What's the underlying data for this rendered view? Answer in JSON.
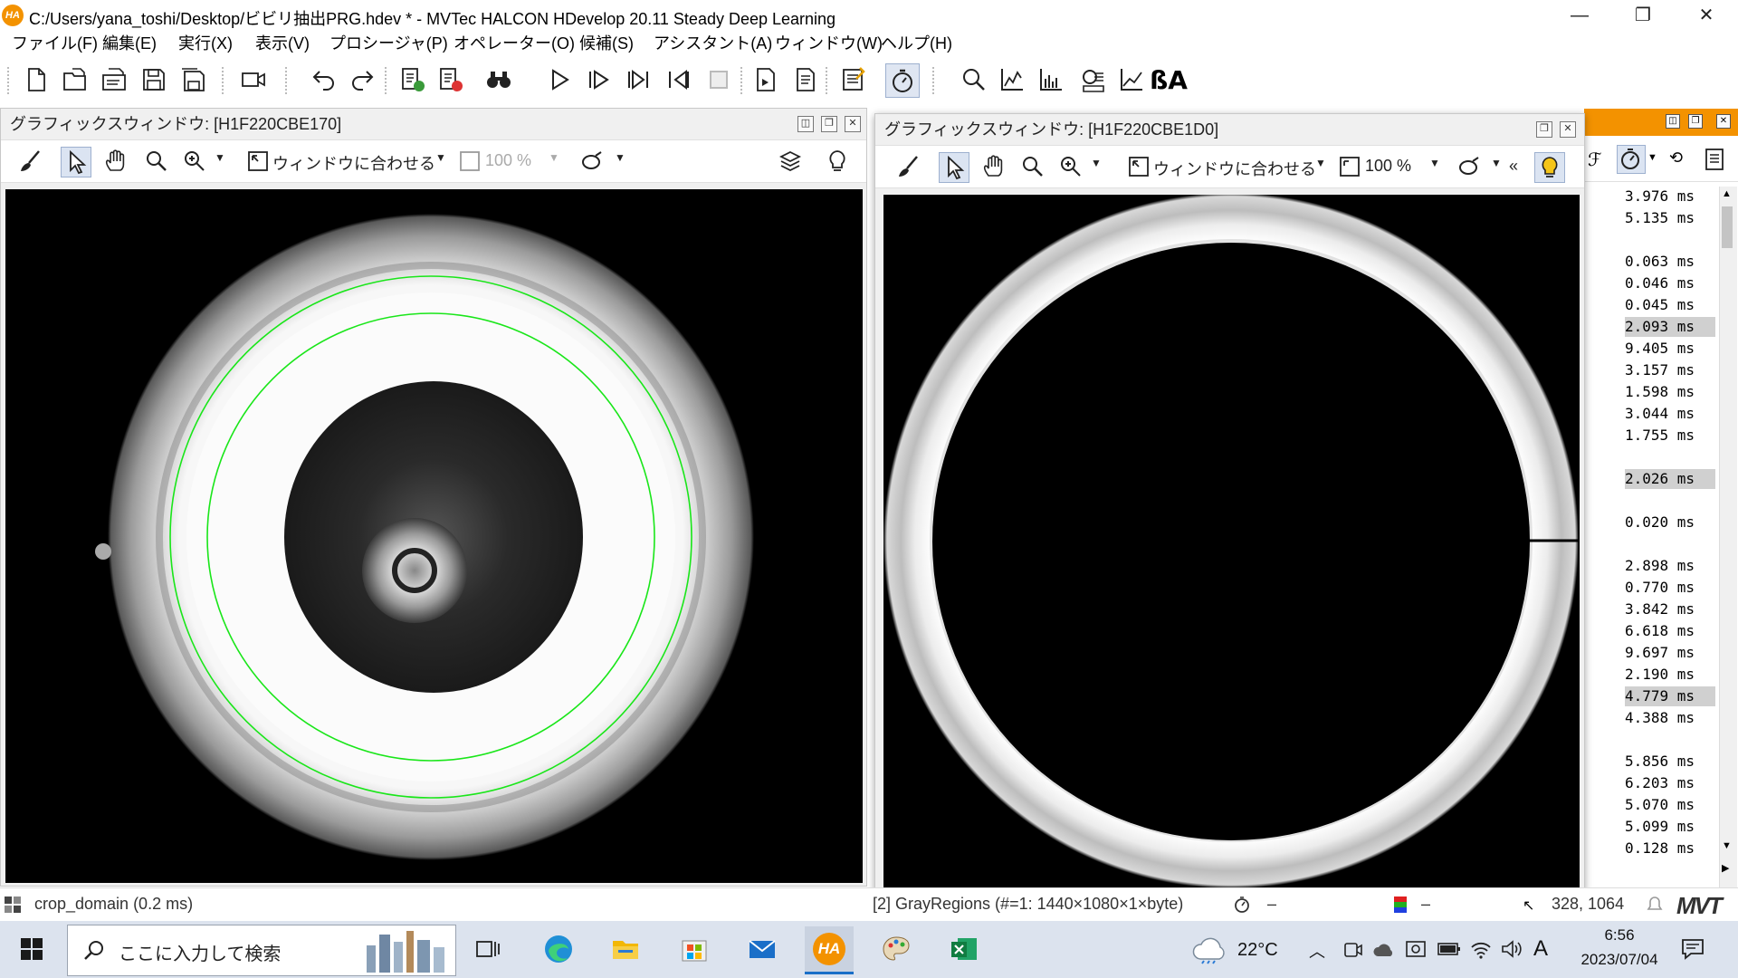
{
  "window": {
    "title": "C:/Users/yana_toshi/Desktop/ビビリ抽出PRG.hdev * - MVTec HALCON HDevelop 20.11 Steady Deep Learning",
    "app_icon_label": "HA",
    "minimize": "—",
    "maximize": "❐",
    "close": "✕"
  },
  "menu": [
    "ファイル(F)",
    "編集(E)",
    "実行(X)",
    "表示(V)",
    "プロシージャ(P)",
    "オペレーター(O)",
    "候補(S)",
    "アシスタント(A)",
    "ウィンドウ(W)",
    "ヘルプ(H)"
  ],
  "graphics_window_1": {
    "title": "グラフィックスウィンドウ: [H1F220CBE170]",
    "fit_label": "ウィンドウに合わせる",
    "zoom_value": "100 %"
  },
  "graphics_window_2": {
    "title": "グラフィックスウィンドウ: [H1F220CBE1D0]",
    "fit_label": "ウィンドウに合わせる",
    "zoom_value": "100 %",
    "collapse_label": "«"
  },
  "timings": [
    {
      "text": "3.976 ms",
      "hl": false
    },
    {
      "text": "5.135 ms",
      "hl": false
    },
    {
      "text": "",
      "hl": false
    },
    {
      "text": "0.063 ms",
      "hl": false
    },
    {
      "text": "0.046 ms",
      "hl": false
    },
    {
      "text": "0.045 ms",
      "hl": false
    },
    {
      "text": "2.093 ms",
      "hl": true
    },
    {
      "text": "9.405 ms",
      "hl": false
    },
    {
      "text": "3.157 ms",
      "hl": false
    },
    {
      "text": "1.598 ms",
      "hl": false
    },
    {
      "text": "3.044 ms",
      "hl": false
    },
    {
      "text": "1.755 ms",
      "hl": false
    },
    {
      "text": "",
      "hl": false
    },
    {
      "text": "2.026 ms",
      "hl": true
    },
    {
      "text": "",
      "hl": false
    },
    {
      "text": "0.020 ms",
      "hl": false
    },
    {
      "text": "",
      "hl": false
    },
    {
      "text": "2.898 ms",
      "hl": false
    },
    {
      "text": "0.770 ms",
      "hl": false
    },
    {
      "text": "3.842 ms",
      "hl": false
    },
    {
      "text": "6.618 ms",
      "hl": false
    },
    {
      "text": "9.697 ms",
      "hl": false
    },
    {
      "text": "2.190 ms",
      "hl": false
    },
    {
      "text": "4.779 ms",
      "hl": true
    },
    {
      "text": "4.388 ms",
      "hl": false
    },
    {
      "text": "",
      "hl": false
    },
    {
      "text": "5.856 ms",
      "hl": false
    },
    {
      "text": "6.203 ms",
      "hl": false
    },
    {
      "text": "5.070 ms",
      "hl": false
    },
    {
      "text": "5.099 ms",
      "hl": false
    },
    {
      "text": "0.128 ms",
      "hl": false
    }
  ],
  "status": {
    "operator": "crop_domain (0.2 ms)",
    "image_info": "[2] GrayRegions (#=1: 1440×1080×1×byte)",
    "dash1": "–",
    "dash2": "–",
    "coords": "328, 1064"
  },
  "taskbar": {
    "search_placeholder": "ここに入力して検索",
    "weather": "22°C",
    "ime": "A",
    "time": "6:56",
    "date": "2023/07/04",
    "halcon_label": "HA"
  },
  "colors": {
    "accent_orange": "#f39200",
    "overlay_green": "#19e619",
    "taskbar_bg": "#dce3ee"
  }
}
